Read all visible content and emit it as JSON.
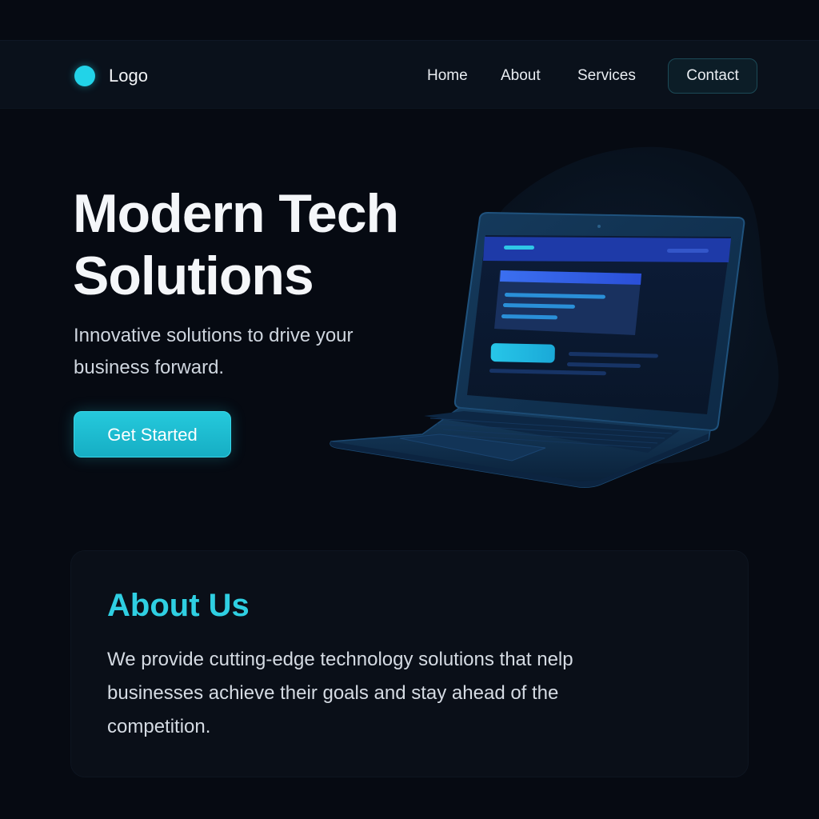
{
  "header": {
    "logo_text": "Logo",
    "nav": {
      "home": "Home",
      "about": "About",
      "services": "Services",
      "contact": "Contact"
    }
  },
  "hero": {
    "title": "Modern Tech Solutions",
    "subtitle": "Innovative solutions to drive your business forward.",
    "cta_label": "Get Started"
  },
  "about": {
    "heading": "About Us",
    "body": "We provide cutting-edge technology solutions that nelp businesses achieve their goals and stay ahead of the competition."
  },
  "colors": {
    "background": "#060a12",
    "accent": "#22d3e8",
    "heading_accent": "#2fcfe2",
    "laptop_screen_header": "#1e3aa8"
  },
  "icons": {
    "logo_mark": "cyan-circle",
    "illustration": "laptop"
  }
}
